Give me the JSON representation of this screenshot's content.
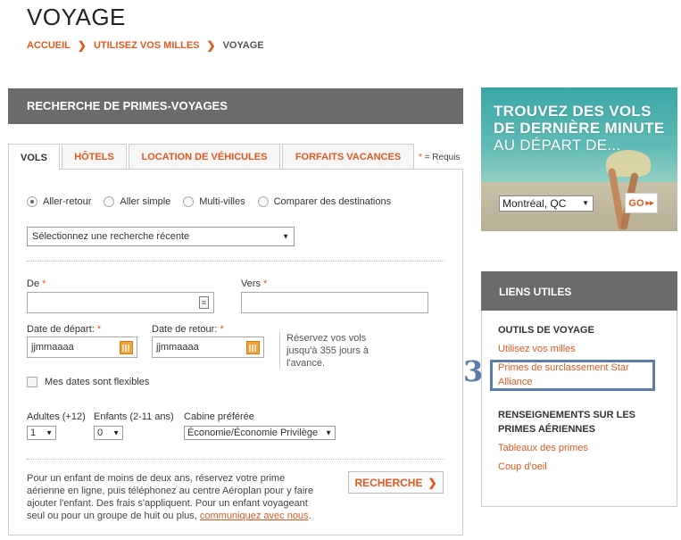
{
  "page": {
    "title": "VOYAGE",
    "breadcrumb": [
      "ACCUEIL",
      "UTILISEZ VOS MILLES",
      "VOYAGE"
    ]
  },
  "search": {
    "header": "RECHERCHE DE PRIMES-VOYAGES",
    "tabs": [
      "VOLS",
      "HÔTELS",
      "LOCATION DE VÉHICULES",
      "FORFAITS VACANCES"
    ],
    "required_note": "= Requis",
    "trip_types": [
      "Aller-retour",
      "Aller simple",
      "Multi-villes",
      "Comparer des destinations"
    ],
    "recent_search_placeholder": "Sélectionnez une recherche récente",
    "from_label": "De",
    "to_label": "Vers",
    "depart_label": "Date de départ:",
    "return_label": "Date de retour:",
    "date_placeholder": "jjmmaaaa",
    "hint": "Réservez vos vols jusqu'à 355 jours à l'avance.",
    "flexible_label": "Mes dates sont flexibles",
    "adults_label": "Adultes (+12)",
    "adults_value": "1",
    "children_label": "Enfants (2-11 ans)",
    "children_value": "0",
    "cabin_label": "Cabine préférée",
    "cabin_value": "Économie/Économie Privilège",
    "note": "Pour un enfant de moins de deux ans, réservez votre prime aérienne en ligne, puis téléphonez au centre Aéroplan pour y faire ajouter l'enfant. Des frais s'appliquent. Pour un enfant voyageant seul ou pour un groupe de huit ou plus,",
    "note_link": "communiquez avec nous",
    "note_end": ".",
    "search_button": "RECHERCHE"
  },
  "promo": {
    "line1": "TROUVEZ DES VOLS",
    "line2": "DE DERNIÈRE MINUTE",
    "line3": "AU DÉPART DE...",
    "city": "Montréal, QC",
    "go": "GO"
  },
  "links": {
    "header": "LIENS UTILES",
    "section1": "OUTILS DE VOYAGE",
    "link1": "Utilisez vos milles",
    "link2": "Primes de surclassement Star Alliance",
    "section2": "RENSEIGNEMENTS SUR LES PRIMES AÉRIENNES",
    "link3": "Tableaux des primes",
    "link4": "Coup d'oeil"
  },
  "annotation": {
    "marker": "3",
    "color": "#5a7dab"
  },
  "colors": {
    "accent": "#e05a1e",
    "header_bg": "#6b6b6b"
  }
}
